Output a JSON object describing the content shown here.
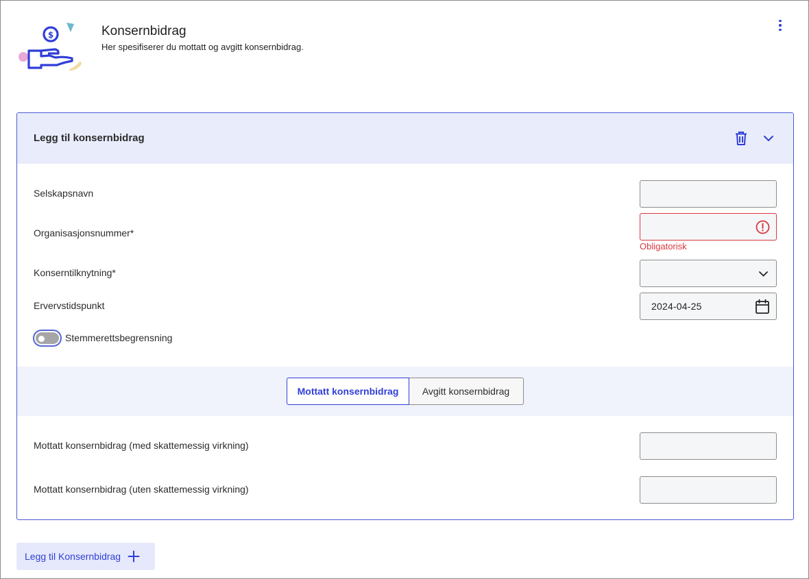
{
  "header": {
    "title": "Konsernbidrag",
    "subtitle": "Her spesifiserer du mottatt og avgitt konsernbidrag.",
    "menu_icon": "kebab-vertical-icon",
    "illustration_icon": "hand-with-coin-icon"
  },
  "card": {
    "title": "Legg til konsernbidrag",
    "delete_icon": "trash-icon",
    "collapse_icon": "chevron-down-icon",
    "fields": {
      "company_name": {
        "label": "Selskapsnavn",
        "value": ""
      },
      "org_number": {
        "label": "Organisasjonsnummer*",
        "value": "",
        "error": "Obligatorisk"
      },
      "group_relation": {
        "label": "Konserntilknytning*",
        "selected": ""
      },
      "acquisition_date": {
        "label": "Ervervstidspunkt",
        "value": "2024-04-25"
      }
    },
    "toggle": {
      "label": "Stemmerettsbegrensning",
      "checked": false
    },
    "tabs": [
      {
        "label": "Mottatt konsernbidrag",
        "active": true
      },
      {
        "label": "Avgitt konsernbidrag",
        "active": false
      }
    ],
    "received": {
      "with_tax": {
        "label": "Mottatt konsernbidrag (med skattemessig virkning)",
        "value": ""
      },
      "without_tax": {
        "label": "Mottatt konsernbidrag (uten skattemessig virkning)",
        "value": ""
      }
    }
  },
  "add_button": {
    "label": "Legg til Konsernbidrag",
    "icon": "plus-icon"
  },
  "colors": {
    "accent": "#2f3fd6",
    "error": "#d9383f",
    "card_header_bg": "#e9ecfb",
    "tab_band_bg": "#f0f2fc"
  }
}
